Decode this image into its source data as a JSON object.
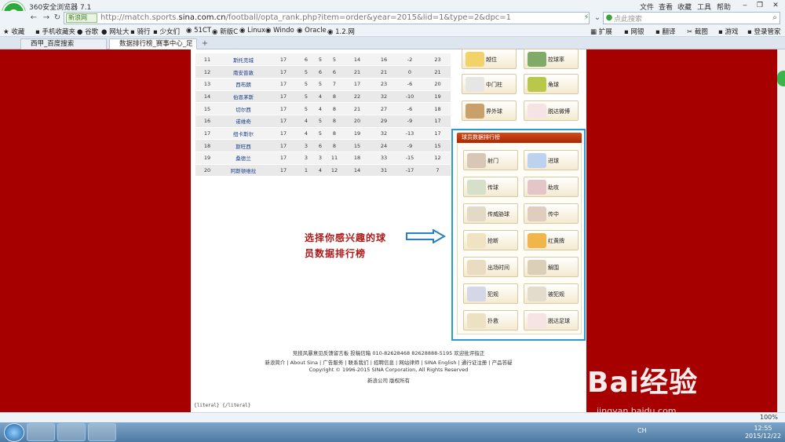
{
  "window": {
    "app_name": "360安全浏览器 7.1",
    "menu": [
      "文件",
      "查看",
      "收藏",
      "工具",
      "帮助"
    ]
  },
  "address_bar": {
    "net_badge": "新浪网",
    "url_prefix": "http://match.sports.",
    "url_domain": "sina.com.cn",
    "url_path": "/football/opta_rank.php?item=order&year=2015&lid=1&type=2&dpc=1",
    "search_placeholder": "点此搜索"
  },
  "bookmarks": {
    "left": [
      "收藏",
      "手机收藏夹",
      "谷歌",
      "网址大",
      "骑行",
      "少女们",
      "51CT",
      "新版C",
      "Linux",
      "Windo",
      "Oracle",
      "1.2.网"
    ],
    "right": [
      "扩展",
      "网银",
      "翻译",
      "截图",
      "游戏",
      "登录管家"
    ]
  },
  "tabs": [
    {
      "label": "西甲_百度搜索"
    },
    {
      "label": "数据排行榜_赛事中心_足"
    }
  ],
  "rank_table": {
    "rows": [
      [
        "11",
        "斯托克城",
        "17",
        "6",
        "5",
        "5",
        "14",
        "16",
        "-2",
        "23"
      ],
      [
        "12",
        "南安普敦",
        "17",
        "5",
        "6",
        "6",
        "21",
        "21",
        "0",
        "21"
      ],
      [
        "13",
        "西布朗",
        "17",
        "5",
        "5",
        "7",
        "17",
        "23",
        "-6",
        "20"
      ],
      [
        "14",
        "伯恩茅斯",
        "17",
        "5",
        "4",
        "8",
        "22",
        "32",
        "-10",
        "19"
      ],
      [
        "15",
        "切尔西",
        "17",
        "5",
        "4",
        "8",
        "21",
        "27",
        "-6",
        "18"
      ],
      [
        "16",
        "诺维奇",
        "17",
        "4",
        "5",
        "8",
        "20",
        "29",
        "-9",
        "17"
      ],
      [
        "17",
        "纽卡斯尔",
        "17",
        "4",
        "5",
        "8",
        "19",
        "32",
        "-13",
        "17"
      ],
      [
        "18",
        "斯旺西",
        "17",
        "3",
        "6",
        "8",
        "15",
        "24",
        "-9",
        "15"
      ],
      [
        "19",
        "桑德兰",
        "17",
        "3",
        "3",
        "11",
        "18",
        "33",
        "-15",
        "12"
      ],
      [
        "20",
        "阿斯顿维拉",
        "17",
        "1",
        "4",
        "12",
        "14",
        "31",
        "-17",
        "7"
      ]
    ]
  },
  "team_rank_buttons": [
    {
      "label": "越位",
      "icon": "flag-icon"
    },
    {
      "label": "控球率",
      "icon": "dribble-icon"
    },
    {
      "label": "中门柱",
      "icon": "goalpost-icon"
    },
    {
      "label": "角球",
      "icon": "corner-icon"
    },
    {
      "label": "界外球",
      "icon": "throwin-icon"
    },
    {
      "label": "脱达微博",
      "icon": "bike-icon"
    }
  ],
  "player_panel": {
    "title": "球员数据排行榜",
    "buttons": [
      {
        "label": "射门",
        "icon": "shot-icon"
      },
      {
        "label": "进球",
        "icon": "goal-icon"
      },
      {
        "label": "传球",
        "icon": "pass-icon"
      },
      {
        "label": "助攻",
        "icon": "assist-icon"
      },
      {
        "label": "传威胁球",
        "icon": "key-pass-icon"
      },
      {
        "label": "传中",
        "icon": "cross-icon"
      },
      {
        "label": "抢断",
        "icon": "tackle-icon"
      },
      {
        "label": "红黄牌",
        "icon": "card-icon"
      },
      {
        "label": "出场时间",
        "icon": "clock-icon"
      },
      {
        "label": "解围",
        "icon": "clearance-icon"
      },
      {
        "label": "犯规",
        "icon": "foul-icon"
      },
      {
        "label": "被犯规",
        "icon": "fouled-icon"
      },
      {
        "label": "扑救",
        "icon": "save-icon"
      },
      {
        "label": "脱达足球",
        "icon": "bike-icon"
      }
    ]
  },
  "annotation": {
    "line1": "选择你感兴趣的球",
    "line2": "员数据排行榜"
  },
  "footer": {
    "line1": "竞技风暴意见反馈留言板 投稿信箱 010-82628468 82628888-5195 欢迎批评指正",
    "line2": "新浪简介 | About Sina | 广告服务 | 联系我们 | 招聘信息 | 网站律师 | SINA English | 通行证注册 | 产品答疑",
    "line3": "Copyright © 1996-2015 SINA Corporation, All Rights Reserved",
    "line4": "新浪公司 版权所有"
  },
  "literal_text": "{literal} {/literal}",
  "status_bar": {
    "zoom": "100%"
  },
  "taskbar": {
    "clock_time": "12:55",
    "clock_date": "2015/12/22",
    "tray_lang": "CH"
  },
  "watermark": {
    "text": "Bai经验",
    "sub": "jingyan.baidu.com"
  },
  "colors": {
    "page_red": "#a60000",
    "highlight_box": "#2a9bd1",
    "panel_header": "#c33a10",
    "annotation": "#b01818"
  }
}
